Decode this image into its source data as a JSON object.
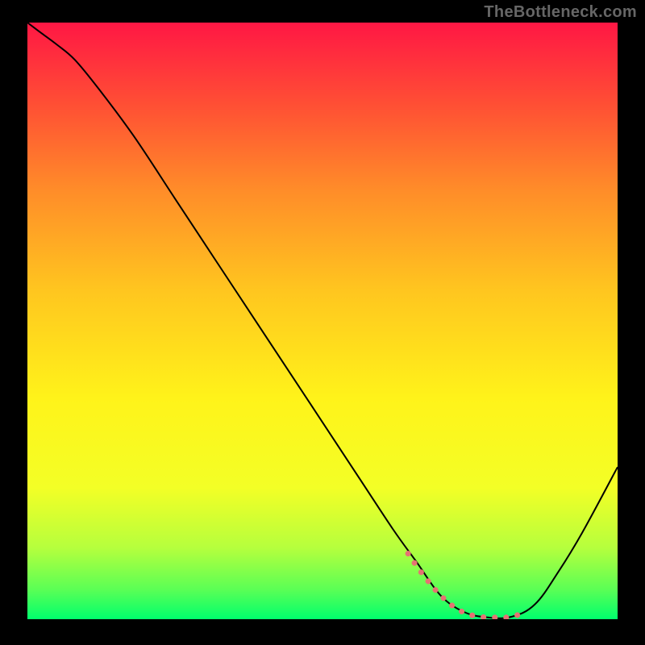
{
  "watermark": "TheBottleneck.com",
  "chart_data": {
    "type": "line",
    "title": "",
    "xlabel": "",
    "ylabel": "",
    "xlim": [
      0,
      100
    ],
    "ylim": [
      0,
      100
    ],
    "grid": false,
    "legend": false,
    "background_gradient": [
      "#ff1744",
      "#ff5034",
      "#ff8c29",
      "#ffc61f",
      "#fff31a",
      "#f3ff26",
      "#b6ff3d",
      "#5bff55",
      "#00ff6d"
    ],
    "series": [
      {
        "name": "curve",
        "color": "#000000",
        "stroke_width": 2,
        "x": [
          0.0,
          2.0,
          5.0,
          8.0,
          12.0,
          18.0,
          25.0,
          32.0,
          40.0,
          48.0,
          56.0,
          62.0,
          66.0,
          70.0,
          74.0,
          78.0,
          82.0,
          86.0,
          90.0,
          94.0,
          100.0
        ],
        "y": [
          100.0,
          98.5,
          96.3,
          93.8,
          89.0,
          81.0,
          70.5,
          60.0,
          48.0,
          36.0,
          24.0,
          15.0,
          9.5,
          4.0,
          1.2,
          0.3,
          0.4,
          2.5,
          8.0,
          14.5,
          25.5
        ]
      },
      {
        "name": "highlight",
        "color": "#e57373",
        "stroke_width": 7,
        "linecap": "round",
        "dash": "0.1 14",
        "x": [
          64.5,
          67.0,
          70.0,
          73.0,
          76.0,
          79.0,
          82.0,
          84.5
        ],
        "y": [
          11.0,
          7.5,
          4.0,
          1.6,
          0.5,
          0.3,
          0.4,
          1.3
        ]
      }
    ]
  }
}
